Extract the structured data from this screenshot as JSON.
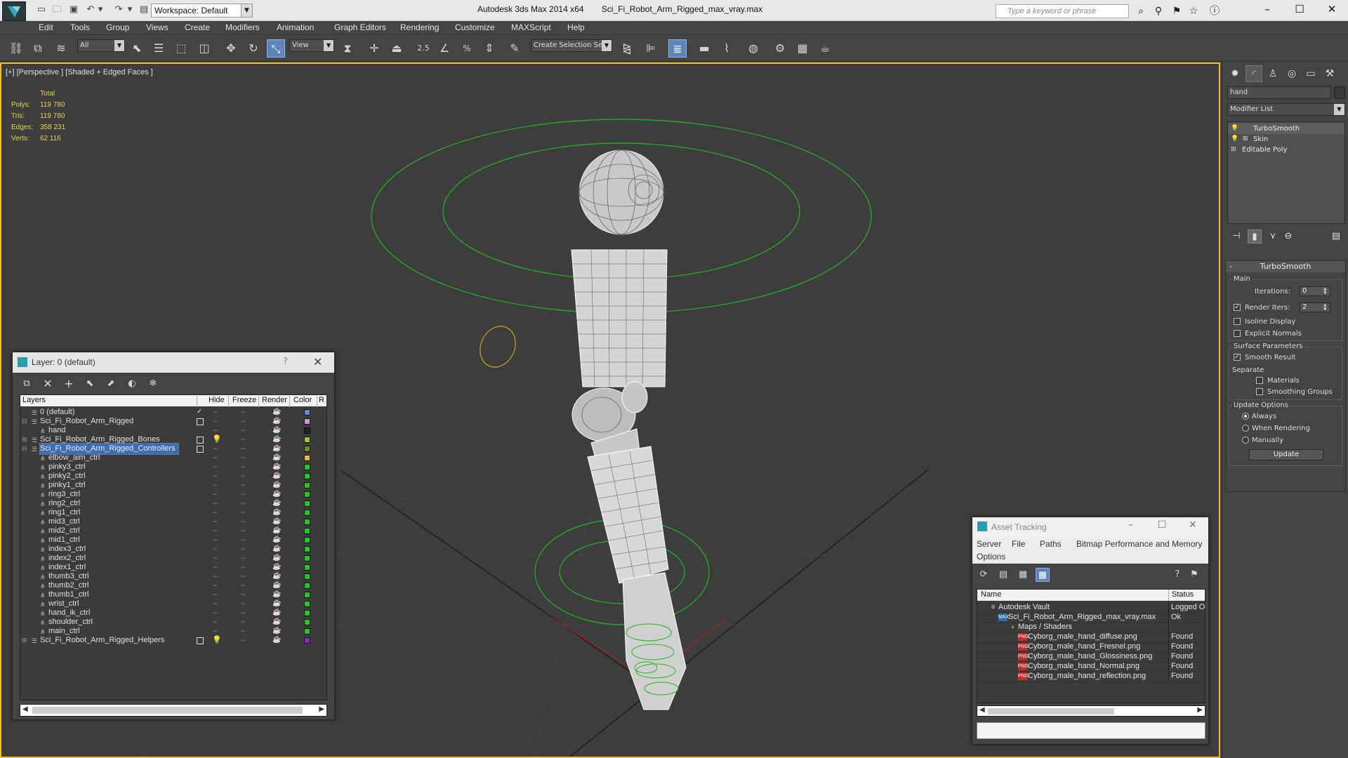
{
  "titlebar": {
    "workspace": "Workspace: Default",
    "app_name": "Autodesk 3ds Max  2014 x64",
    "file_name": "Sci_Fi_Robot_Arm_Rigged_max_vray.max",
    "search_placeholder": "Type a keyword or phrase"
  },
  "menu": [
    "Edit",
    "Tools",
    "Group",
    "Views",
    "Create",
    "Modifiers",
    "Animation",
    "Graph Editors",
    "Rendering",
    "Customize",
    "MAXScript",
    "Help"
  ],
  "toolbar": {
    "filter": "All",
    "ref_coord": "View",
    "selection_set": "Create Selection Se",
    "angle_snap": "2.5"
  },
  "viewport": {
    "label": "[+] [Perspective ] [Shaded + Edged Faces ]",
    "stats": {
      "header": "Total",
      "rows": [
        {
          "k": "Polys:",
          "v": "119 780"
        },
        {
          "k": "Tris:",
          "v": "119 780"
        },
        {
          "k": "Edges:",
          "v": "358 231"
        },
        {
          "k": "Verts:",
          "v": "62 116"
        }
      ]
    }
  },
  "layer_panel": {
    "title": "Layer: 0 (default)",
    "help": "?",
    "columns": {
      "layers": "Layers",
      "hide": "Hide",
      "freeze": "Freeze",
      "render": "Render",
      "color": "Color",
      "extra": "R"
    },
    "rows": [
      {
        "name": "0 (default)",
        "level": 0,
        "expand": "",
        "mark": "check",
        "color": "#5a8fd6"
      },
      {
        "name": "Sci_Fi_Robot_Arm_Rigged",
        "level": 0,
        "expand": "−",
        "mark": "box",
        "color": "#c89ad6"
      },
      {
        "name": "hand",
        "level": 1,
        "expand": "",
        "mark": "",
        "color": "#222222"
      },
      {
        "name": "Sci_Fi_Robot_Arm_Rigged_Bones",
        "level": 0,
        "expand": "+",
        "mark": "box",
        "bulb": true,
        "color": "#9ac832"
      },
      {
        "name": "Sci_Fi_Robot_Arm_Rigged_Controllers",
        "level": 0,
        "expand": "−",
        "mark": "box",
        "color": "#7a8a1a",
        "selected": true
      },
      {
        "name": "elbow_aim_ctrl",
        "level": 1,
        "expand": "",
        "mark": "",
        "color": "#e6b832"
      },
      {
        "name": "pinky3_ctrl",
        "level": 1,
        "expand": "",
        "mark": "",
        "color": "#1ec81e"
      },
      {
        "name": "pinky2_ctrl",
        "level": 1,
        "expand": "",
        "mark": "",
        "color": "#1ec81e"
      },
      {
        "name": "pinky1_ctrl",
        "level": 1,
        "expand": "",
        "mark": "",
        "color": "#1ec81e"
      },
      {
        "name": "ring3_ctrl",
        "level": 1,
        "expand": "",
        "mark": "",
        "color": "#1ec81e"
      },
      {
        "name": "ring2_ctrl",
        "level": 1,
        "expand": "",
        "mark": "",
        "color": "#1ec81e"
      },
      {
        "name": "ring1_ctrl",
        "level": 1,
        "expand": "",
        "mark": "",
        "color": "#1ec81e"
      },
      {
        "name": "mid3_ctrl",
        "level": 1,
        "expand": "",
        "mark": "",
        "color": "#1ec81e"
      },
      {
        "name": "mid2_ctrl",
        "level": 1,
        "expand": "",
        "mark": "",
        "color": "#1ec81e"
      },
      {
        "name": "mid1_ctrl",
        "level": 1,
        "expand": "",
        "mark": "",
        "color": "#1ec81e"
      },
      {
        "name": "index3_ctrl",
        "level": 1,
        "expand": "",
        "mark": "",
        "color": "#1ec81e"
      },
      {
        "name": "index2_ctrl",
        "level": 1,
        "expand": "",
        "mark": "",
        "color": "#1ec81e"
      },
      {
        "name": "index1_ctrl",
        "level": 1,
        "expand": "",
        "mark": "",
        "color": "#1ec81e"
      },
      {
        "name": "thumb3_ctrl",
        "level": 1,
        "expand": "",
        "mark": "",
        "color": "#1ec81e"
      },
      {
        "name": "thumb2_ctrl",
        "level": 1,
        "expand": "",
        "mark": "",
        "color": "#1ec81e"
      },
      {
        "name": "thumb1_ctrl",
        "level": 1,
        "expand": "",
        "mark": "",
        "color": "#1ec81e"
      },
      {
        "name": "wrist_ctrl",
        "level": 1,
        "expand": "",
        "mark": "",
        "color": "#1ec81e"
      },
      {
        "name": "hand_ik_ctrl",
        "level": 1,
        "expand": "",
        "mark": "",
        "color": "#1ec81e"
      },
      {
        "name": "shoulder_ctrl",
        "level": 1,
        "expand": "",
        "mark": "",
        "color": "#1ec81e"
      },
      {
        "name": "main_ctrl",
        "level": 1,
        "expand": "",
        "mark": "",
        "color": "#1ec81e"
      },
      {
        "name": "Sci_Fi_Robot_Arm_Rigged_Helpers",
        "level": 0,
        "expand": "+",
        "mark": "box",
        "bulb": true,
        "color": "#9a1ec8"
      }
    ]
  },
  "command_panel": {
    "object_name": "hand",
    "modifier_list": "Modifier List",
    "stack": [
      {
        "name": "TurboSmooth",
        "bulb": true,
        "sub": false
      },
      {
        "name": "Skin",
        "bulb": true,
        "sub": true
      },
      {
        "name": "Editable Poly",
        "bulb": false,
        "sub": false
      }
    ],
    "rollout": {
      "title": "TurboSmooth",
      "collapse": "-",
      "main_group": "Main",
      "iterations_label": "Iterations:",
      "iterations_value": "0",
      "render_iters_label": "Render Iters:",
      "render_iters_value": "2",
      "isoline": "Isoline Display",
      "explicit_normals": "Explicit Normals",
      "surface_group": "Surface Parameters",
      "smooth_result": "Smooth Result",
      "separate": "Separate",
      "materials": "Materials",
      "smoothing_groups": "Smoothing Groups",
      "update_group": "Update Options",
      "always": "Always",
      "when_rendering": "When Rendering",
      "manually": "Manually",
      "update_button": "Update"
    }
  },
  "asset_panel": {
    "title": "Asset Tracking",
    "menu": [
      "Server",
      "File",
      "Paths",
      "Bitmap Performance and Memory",
      "Options"
    ],
    "columns": {
      "name": "Name",
      "status": "Status"
    },
    "rows": [
      {
        "name": "Autodesk Vault",
        "status": "Logged O",
        "indent": 0,
        "icon": "vault"
      },
      {
        "name": "Sci_Fi_Robot_Arm_Rigged_max_vray.max",
        "status": "Ok",
        "indent": 1,
        "icon": "max"
      },
      {
        "name": "Maps / Shaders",
        "status": "",
        "indent": 2,
        "icon": "maps"
      },
      {
        "name": "Cyborg_male_hand_diffuse.png",
        "status": "Found",
        "indent": 3,
        "icon": "png"
      },
      {
        "name": "Cyborg_male_hand_Fresnel.png",
        "status": "Found",
        "indent": 3,
        "icon": "png"
      },
      {
        "name": "Cyborg_male_hand_Glossiness.png",
        "status": "Found",
        "indent": 3,
        "icon": "png"
      },
      {
        "name": "Cyborg_male_hand_Normal.png",
        "status": "Found",
        "indent": 3,
        "icon": "png"
      },
      {
        "name": "Cyborg_male_hand_reflection.png",
        "status": "Found",
        "indent": 3,
        "icon": "png"
      }
    ]
  }
}
